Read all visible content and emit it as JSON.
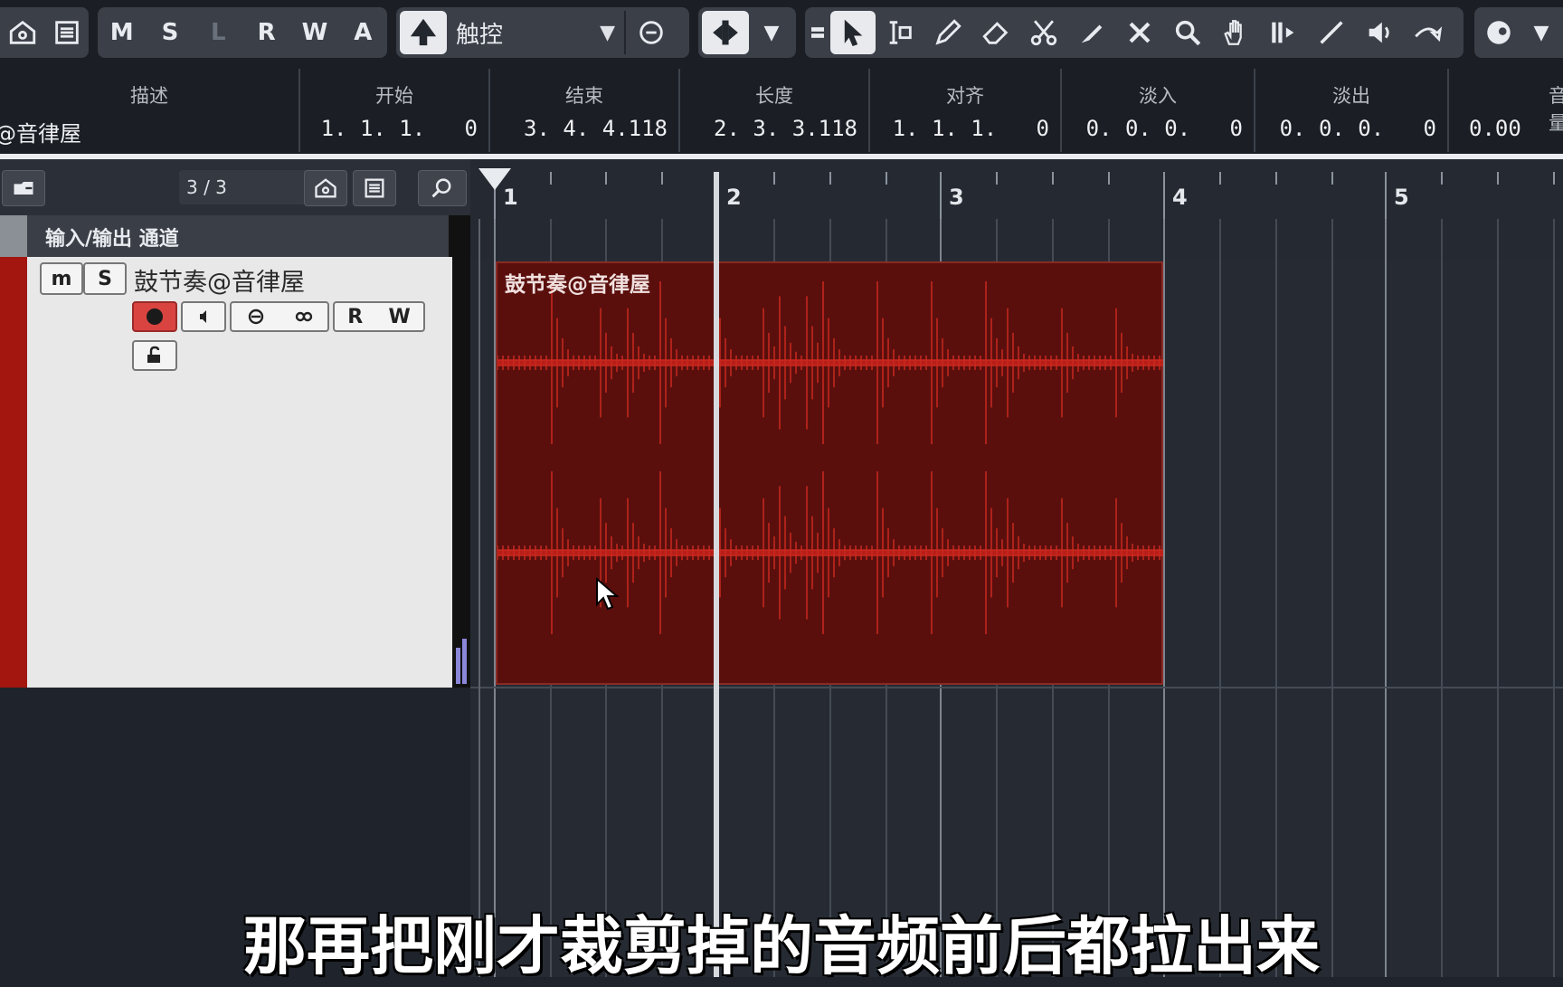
{
  "toolbar": {
    "automation_buttons": [
      "M",
      "S",
      "L",
      "R",
      "W",
      "A"
    ],
    "mode_label": "触控",
    "colors": {
      "bg": "#1b1e24",
      "group": "#3a3f48",
      "selected": "#e8eaee"
    }
  },
  "infoline": {
    "columns": [
      {
        "head": "描述",
        "value": "@音律屋"
      },
      {
        "head": "开始",
        "value": "1. 1. 1.   0"
      },
      {
        "head": "结束",
        "value": "3. 4. 4.118"
      },
      {
        "head": "长度",
        "value": "2. 3. 3.118"
      },
      {
        "head": "对齐",
        "value": "1. 1. 1.   0"
      },
      {
        "head": "淡入",
        "value": "0. 0. 0.   0"
      },
      {
        "head": "淡出",
        "value": "0. 0. 0.   0"
      },
      {
        "head": "音量",
        "value": "0.00"
      }
    ]
  },
  "tracklist": {
    "count": "3 / 3",
    "folder_label": "输入/输出 通道",
    "track": {
      "name": "鼓节奏@音律屋",
      "mute": "m",
      "solo": "S",
      "read": "R",
      "write": "W",
      "color": "#a3150f"
    }
  },
  "ruler": {
    "bars": [
      "1",
      "2",
      "3",
      "4",
      "5"
    ]
  },
  "event": {
    "name": "鼓节奏@音律屋",
    "color": "#5a0f0d",
    "wave_color": "#c0201a"
  },
  "subtitle": "那再把刚才裁剪掉的音频前后都拉出来"
}
